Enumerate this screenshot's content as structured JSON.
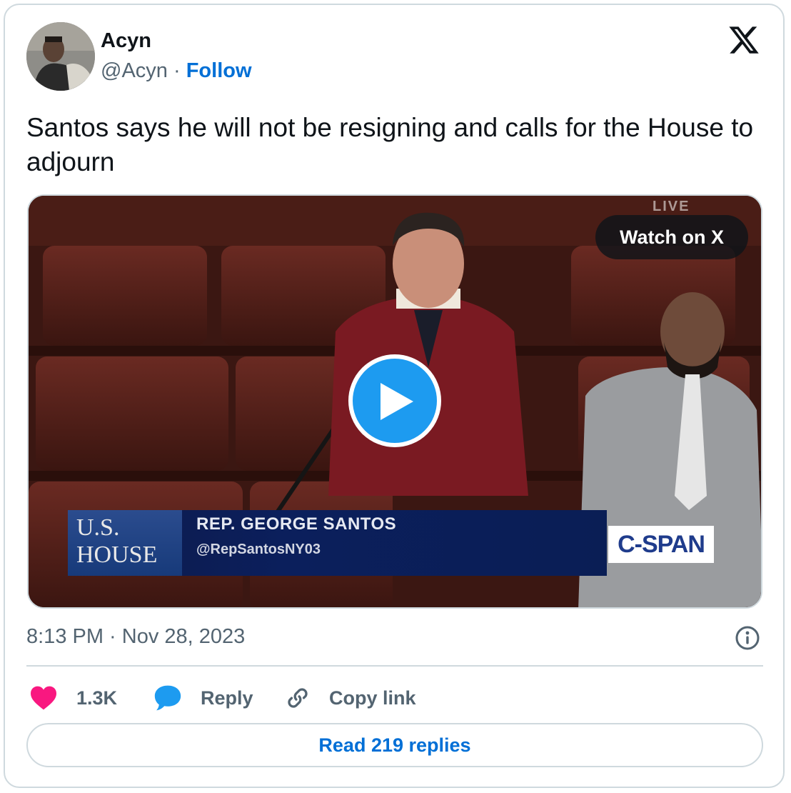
{
  "author": {
    "name": "Acyn",
    "handle": "@Acyn",
    "separator": "·",
    "follow_label": "Follow"
  },
  "tweet": {
    "text": "Santos says he will not be resigning and calls for the House to adjourn",
    "timestamp": "8:13 PM · Nov 28, 2023"
  },
  "media": {
    "watch_label": "Watch on X",
    "live_tag": "LIVE",
    "lower_third": {
      "logo_line1": "U.S.",
      "logo_line2": "HOUSE",
      "name": "REP. GEORGE SANTOS",
      "handle": "@RepSantosNY03"
    },
    "network": "C-SPAN"
  },
  "actions": {
    "likes": "1.3K",
    "reply_label": "Reply",
    "copy_label": "Copy link"
  },
  "read_replies_label": "Read 219 replies",
  "colors": {
    "accent": "#1d9bf0",
    "follow": "#006fd6",
    "like": "#f91880",
    "muted": "#536471",
    "border": "#cfd9de"
  },
  "icons": [
    "x-logo-icon",
    "play-icon",
    "info-icon",
    "heart-icon",
    "reply-bubble-icon",
    "link-icon"
  ]
}
